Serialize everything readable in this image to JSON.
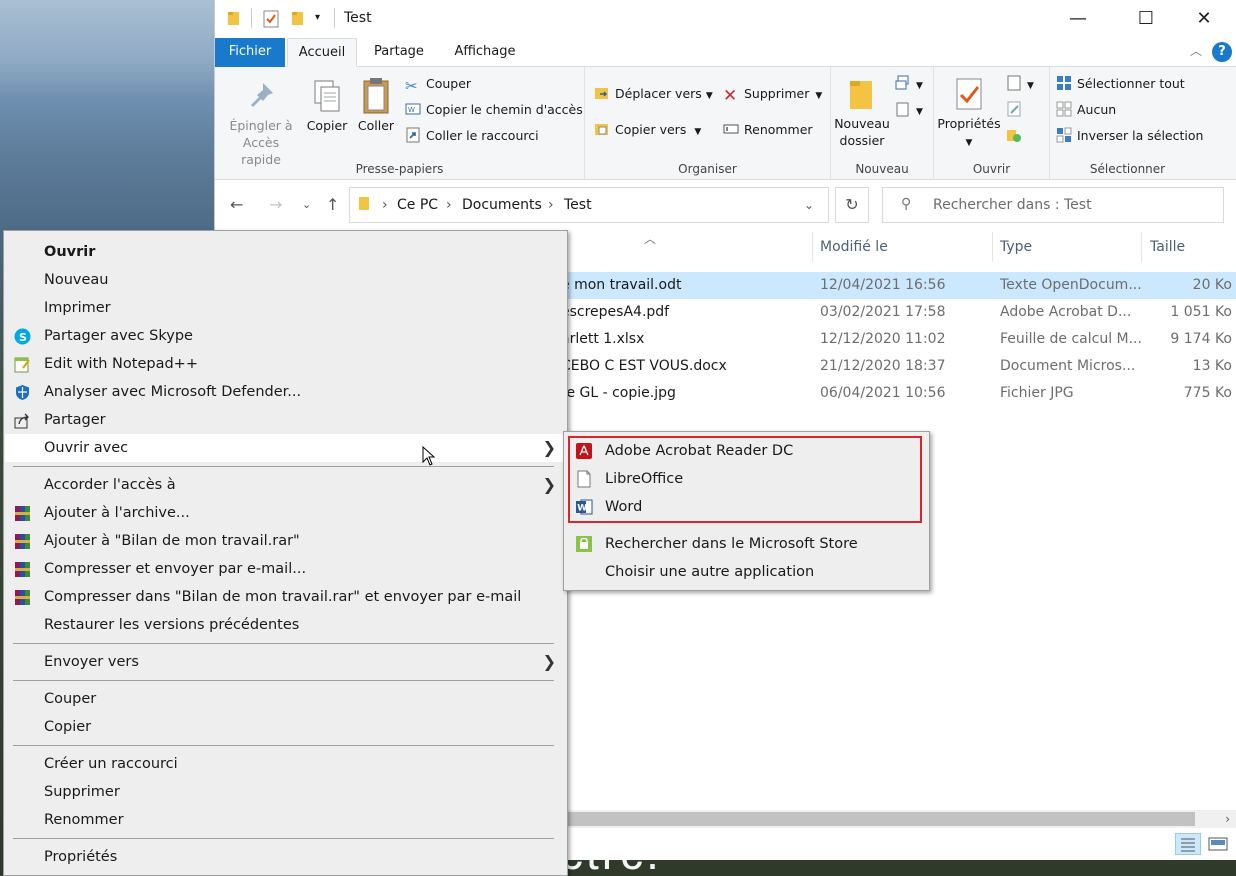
{
  "window": {
    "title": "Test",
    "minimize": "—",
    "maximize": "☐",
    "close": "✕"
  },
  "ribbon_tabs": {
    "fichier": "Fichier",
    "accueil": "Accueil",
    "partage": "Partage",
    "affichage": "Affichage"
  },
  "ribbon": {
    "presse_papiers": {
      "label": "Presse-papiers",
      "epingler": "Épingler à Accès rapide",
      "epingler_line1": "Épingler à",
      "epingler_line2": "Accès rapide",
      "copier": "Copier",
      "coller": "Coller",
      "couper": "Couper",
      "copier_chemin": "Copier le chemin d'accès",
      "coller_raccourci": "Coller le raccourci"
    },
    "organiser": {
      "label": "Organiser",
      "deplacer_vers": "Déplacer vers",
      "copier_vers": "Copier vers",
      "supprimer": "Supprimer",
      "renommer": "Renommer"
    },
    "nouveau": {
      "label": "Nouveau",
      "nouveau_dossier_line1": "Nouveau",
      "nouveau_dossier_line2": "dossier"
    },
    "ouvrir": {
      "label": "Ouvrir",
      "proprietes": "Propriétés"
    },
    "selectionner": {
      "label": "Sélectionner",
      "selectionner_tout": "Sélectionner tout",
      "aucun": "Aucun",
      "inverser": "Inverser la sélection"
    }
  },
  "address": {
    "crumbs": [
      "Ce PC",
      "Documents",
      "Test"
    ],
    "search_placeholder": "Rechercher dans : Test"
  },
  "columns": {
    "modified": "Modifié le",
    "type": "Type",
    "size": "Taille"
  },
  "files": [
    {
      "name": "e mon travail.odt",
      "date": "12/04/2021 16:56",
      "type": "Texte OpenDocum...",
      "size": "20 Ko",
      "selected": true
    },
    {
      "name": "escrepesA4.pdf",
      "date": "03/02/2021 17:58",
      "type": "Adobe Acrobat D...",
      "size": "1 051 Ko",
      "selected": false
    },
    {
      "name": "arlett 1.xlsx",
      "date": "12/12/2020 11:02",
      "type": "Feuille de calcul M...",
      "size": "9 174 Ko",
      "selected": false
    },
    {
      "name": "CEBO C EST VOUS.docx",
      "date": "21/12/2020 18:37",
      "type": "Document Micros...",
      "size": "13 Ko",
      "selected": false
    },
    {
      "name": "re GL - copie.jpg",
      "date": "06/04/2021 10:56",
      "type": "Fichier JPG",
      "size": "775 Ko",
      "selected": false
    }
  ],
  "context_menu": {
    "ouvrir": "Ouvrir",
    "nouveau": "Nouveau",
    "imprimer": "Imprimer",
    "partager_skype": "Partager avec Skype",
    "notepad": "Edit with Notepad++",
    "defender": "Analyser avec Microsoft Defender...",
    "partager": "Partager",
    "ouvrir_avec": "Ouvrir avec",
    "accorder_acces": "Accorder l'accès à",
    "ajouter_archive": "Ajouter à l'archive...",
    "ajouter_rar": "Ajouter à \"Bilan de mon travail.rar\"",
    "compresser_email": "Compresser et envoyer par e-mail...",
    "compresser_rar_email": "Compresser dans \"Bilan de mon travail.rar\" et envoyer par e-mail",
    "restaurer": "Restaurer les versions précédentes",
    "envoyer_vers": "Envoyer vers",
    "couper": "Couper",
    "copier": "Copier",
    "creer_raccourci": "Créer un raccourci",
    "supprimer": "Supprimer",
    "renommer": "Renommer",
    "proprietes": "Propriétés"
  },
  "submenu": {
    "acrobat": "Adobe Acrobat Reader DC",
    "libreoffice": "LibreOffice",
    "word": "Word",
    "store": "Rechercher dans le Microsoft Store",
    "autre": "Choisir une autre application"
  },
  "desktop": {
    "partial_text": "ctrc."
  },
  "colors": {
    "accent": "#1979ca",
    "selection": "#cce8ff",
    "highlight_box": "#d6262e",
    "menu_bg": "#eeeeee"
  }
}
